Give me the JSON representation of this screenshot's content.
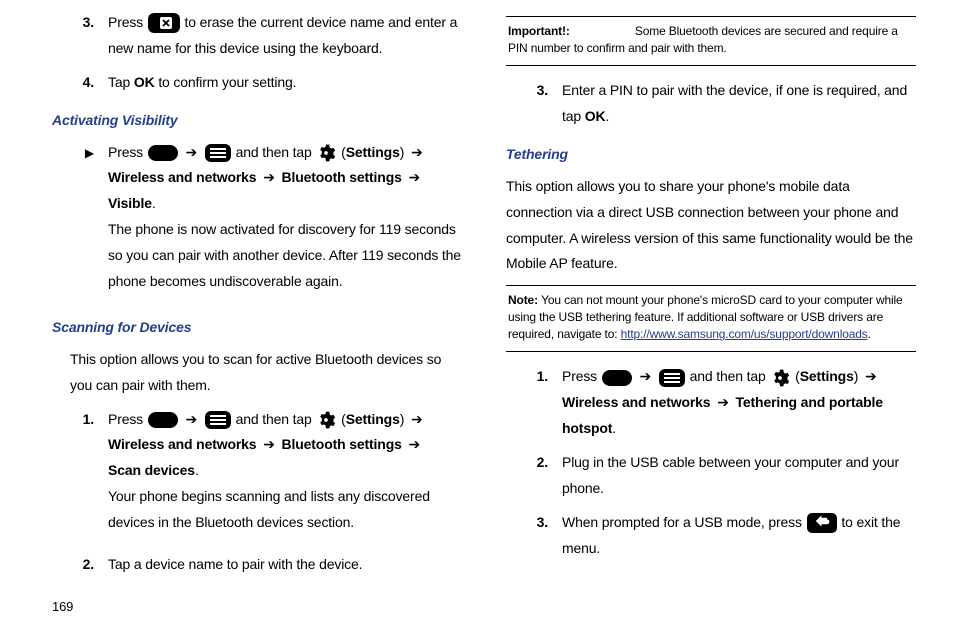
{
  "page_number": "169",
  "left": {
    "item3_pre": "Press ",
    "item3_post": " to erase the current device name and enter a new name for this device using the keyboard.",
    "item4_a": "Tap ",
    "item4_b": "OK",
    "item4_c": " to confirm your setting.",
    "h_vis": "Activating Visibility",
    "vis_a": "Press ",
    "vis_b": " and then tap ",
    "vis_c": " (",
    "vis_settings": "Settings",
    "vis_d": ") ",
    "vis_path1": "Wireless and networks",
    "vis_path2": "Bluetooth settings",
    "vis_path3": "Visible",
    "vis_e": ".",
    "vis_para2": "The phone is now activated for discovery for 119 seconds so you can pair with another device. After 119 seconds the phone becomes undiscoverable again.",
    "h_scan": "Scanning for Devices",
    "scan_intro": "This option allows you to scan for active Bluetooth devices so you can pair with them.",
    "scan1_a": "Press ",
    "scan1_b": " and then tap ",
    "scan1_c": " (",
    "scan1_settings": "Settings",
    "scan1_d": ") ",
    "scan1_path1": "Wireless and networks",
    "scan1_path2": "Bluetooth settings",
    "scan1_path3": "Scan devices",
    "scan1_e": ".",
    "scan1_para2": "Your phone begins scanning and lists any discovered devices in the Bluetooth devices section.",
    "scan2": "Tap a device name to pair with the device."
  },
  "right": {
    "imp_label": "Important!: ",
    "imp_text": "Some Bluetooth devices are secured and require a PIN number to confirm and pair with them.",
    "r3_a": "Enter a PIN to pair with the device, if one is required, and tap ",
    "r3_ok": "OK",
    "r3_b": ".",
    "h_tether": "Tethering",
    "tether_intro": "This option allows you to share your phone's mobile data connection via a direct USB connection between your phone and computer. A wireless version of this same functionality would be the Mobile AP feature.",
    "note_label": "Note: ",
    "note_text_a": "You can not mount your phone's microSD card to your computer while using the USB tethering feature. If additional software or USB drivers are required, navigate to: ",
    "note_link": "http://www.samsung.com/us/support/downloads",
    "note_text_b": ".",
    "t1_a": "Press ",
    "t1_b": " and then tap ",
    "t1_c": " (",
    "t1_settings": "Settings",
    "t1_d": ") ",
    "t1_path1": "Wireless and networks",
    "t1_path2": "Tethering and portable hotspot",
    "t1_e": ".",
    "t2": "Plug in the USB cable between your computer and your phone.",
    "t3_a": "When prompted for a USB mode, press ",
    "t3_b": " to exit the menu."
  },
  "marks": {
    "m3": "3.",
    "m4": "4.",
    "m1": "1.",
    "m2": "2.",
    "tri": "▶",
    "arrow": "➔"
  }
}
